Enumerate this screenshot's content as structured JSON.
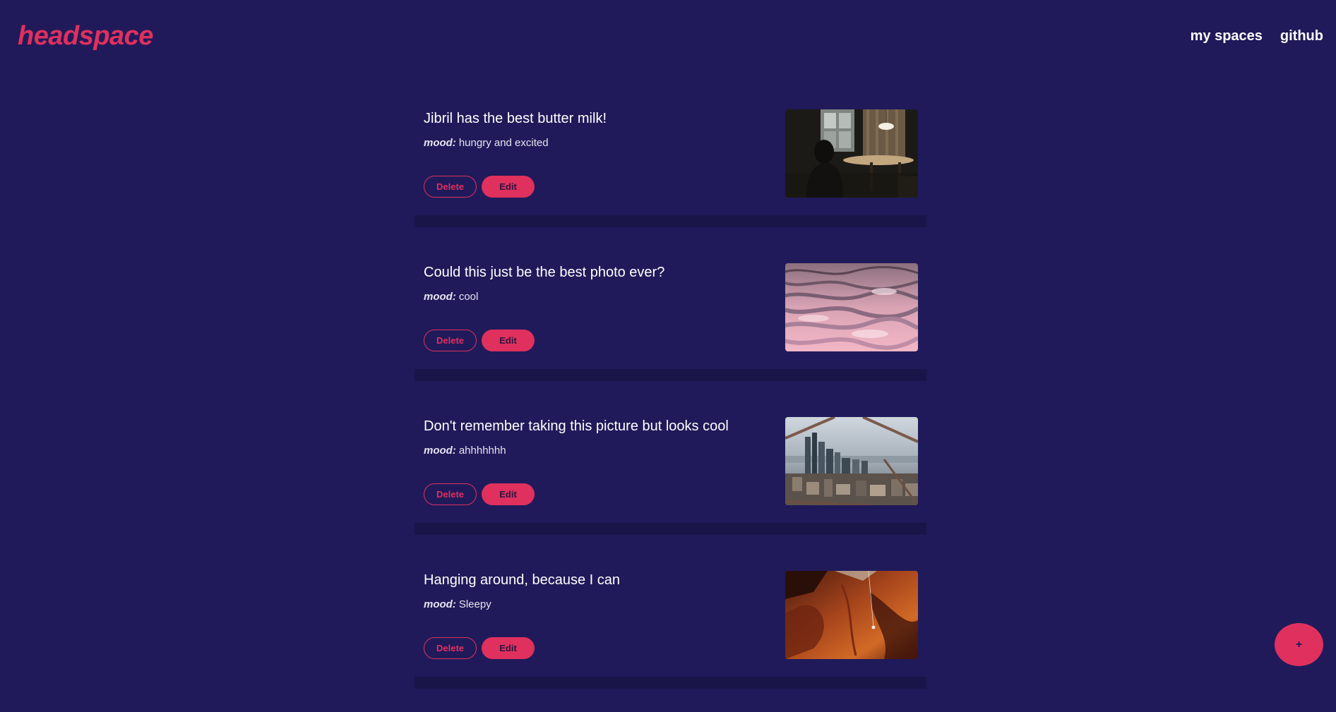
{
  "header": {
    "logo": "headspace",
    "nav": [
      "my spaces",
      "github"
    ]
  },
  "mood_label": "mood:",
  "buttons": {
    "delete": "Delete",
    "edit": "Edit"
  },
  "posts": [
    {
      "title": "Jibril has the best butter milk!",
      "mood": "hungry and excited",
      "image": "dark-dining-room-photo"
    },
    {
      "title": "Could this just be the best photo ever?",
      "mood": "cool",
      "image": "pink-water-ripples-photo"
    },
    {
      "title": "Don't remember taking this picture but looks cool",
      "mood": "ahhhhhhh",
      "image": "city-skyline-photo"
    },
    {
      "title": "Hanging around, because I can",
      "mood": "Sleepy",
      "image": "red-rock-climber-photo"
    }
  ],
  "fab": {
    "label": "+"
  },
  "colors": {
    "background": "#201a5a",
    "accent": "#e0305e",
    "divider": "#1a1548"
  }
}
